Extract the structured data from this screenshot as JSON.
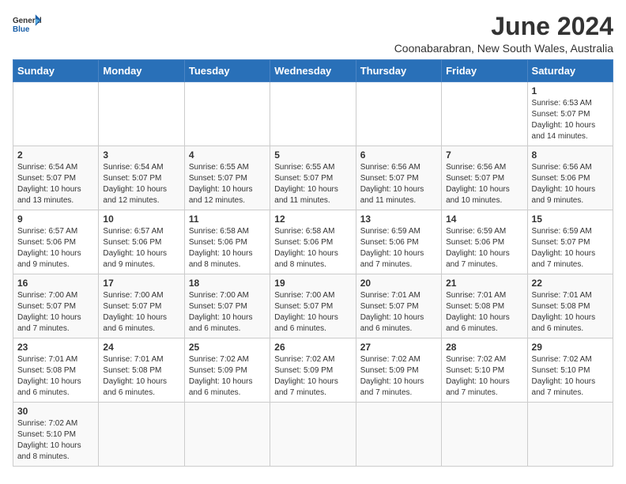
{
  "header": {
    "logo_general": "General",
    "logo_blue": "Blue",
    "month_title": "June 2024",
    "subtitle": "Coonabarabran, New South Wales, Australia"
  },
  "days_of_week": [
    "Sunday",
    "Monday",
    "Tuesday",
    "Wednesday",
    "Thursday",
    "Friday",
    "Saturday"
  ],
  "weeks": [
    {
      "days": [
        {
          "num": "",
          "info": ""
        },
        {
          "num": "",
          "info": ""
        },
        {
          "num": "",
          "info": ""
        },
        {
          "num": "",
          "info": ""
        },
        {
          "num": "",
          "info": ""
        },
        {
          "num": "",
          "info": ""
        },
        {
          "num": "1",
          "info": "Sunrise: 6:53 AM\nSunset: 5:07 PM\nDaylight: 10 hours\nand 14 minutes."
        }
      ]
    },
    {
      "days": [
        {
          "num": "2",
          "info": "Sunrise: 6:54 AM\nSunset: 5:07 PM\nDaylight: 10 hours\nand 13 minutes."
        },
        {
          "num": "3",
          "info": "Sunrise: 6:54 AM\nSunset: 5:07 PM\nDaylight: 10 hours\nand 12 minutes."
        },
        {
          "num": "4",
          "info": "Sunrise: 6:55 AM\nSunset: 5:07 PM\nDaylight: 10 hours\nand 12 minutes."
        },
        {
          "num": "5",
          "info": "Sunrise: 6:55 AM\nSunset: 5:07 PM\nDaylight: 10 hours\nand 11 minutes."
        },
        {
          "num": "6",
          "info": "Sunrise: 6:56 AM\nSunset: 5:07 PM\nDaylight: 10 hours\nand 11 minutes."
        },
        {
          "num": "7",
          "info": "Sunrise: 6:56 AM\nSunset: 5:07 PM\nDaylight: 10 hours\nand 10 minutes."
        },
        {
          "num": "8",
          "info": "Sunrise: 6:56 AM\nSunset: 5:06 PM\nDaylight: 10 hours\nand 9 minutes."
        }
      ]
    },
    {
      "days": [
        {
          "num": "9",
          "info": "Sunrise: 6:57 AM\nSunset: 5:06 PM\nDaylight: 10 hours\nand 9 minutes."
        },
        {
          "num": "10",
          "info": "Sunrise: 6:57 AM\nSunset: 5:06 PM\nDaylight: 10 hours\nand 9 minutes."
        },
        {
          "num": "11",
          "info": "Sunrise: 6:58 AM\nSunset: 5:06 PM\nDaylight: 10 hours\nand 8 minutes."
        },
        {
          "num": "12",
          "info": "Sunrise: 6:58 AM\nSunset: 5:06 PM\nDaylight: 10 hours\nand 8 minutes."
        },
        {
          "num": "13",
          "info": "Sunrise: 6:59 AM\nSunset: 5:06 PM\nDaylight: 10 hours\nand 7 minutes."
        },
        {
          "num": "14",
          "info": "Sunrise: 6:59 AM\nSunset: 5:06 PM\nDaylight: 10 hours\nand 7 minutes."
        },
        {
          "num": "15",
          "info": "Sunrise: 6:59 AM\nSunset: 5:07 PM\nDaylight: 10 hours\nand 7 minutes."
        }
      ]
    },
    {
      "days": [
        {
          "num": "16",
          "info": "Sunrise: 7:00 AM\nSunset: 5:07 PM\nDaylight: 10 hours\nand 7 minutes."
        },
        {
          "num": "17",
          "info": "Sunrise: 7:00 AM\nSunset: 5:07 PM\nDaylight: 10 hours\nand 6 minutes."
        },
        {
          "num": "18",
          "info": "Sunrise: 7:00 AM\nSunset: 5:07 PM\nDaylight: 10 hours\nand 6 minutes."
        },
        {
          "num": "19",
          "info": "Sunrise: 7:00 AM\nSunset: 5:07 PM\nDaylight: 10 hours\nand 6 minutes."
        },
        {
          "num": "20",
          "info": "Sunrise: 7:01 AM\nSunset: 5:07 PM\nDaylight: 10 hours\nand 6 minutes."
        },
        {
          "num": "21",
          "info": "Sunrise: 7:01 AM\nSunset: 5:08 PM\nDaylight: 10 hours\nand 6 minutes."
        },
        {
          "num": "22",
          "info": "Sunrise: 7:01 AM\nSunset: 5:08 PM\nDaylight: 10 hours\nand 6 minutes."
        }
      ]
    },
    {
      "days": [
        {
          "num": "23",
          "info": "Sunrise: 7:01 AM\nSunset: 5:08 PM\nDaylight: 10 hours\nand 6 minutes."
        },
        {
          "num": "24",
          "info": "Sunrise: 7:01 AM\nSunset: 5:08 PM\nDaylight: 10 hours\nand 6 minutes."
        },
        {
          "num": "25",
          "info": "Sunrise: 7:02 AM\nSunset: 5:09 PM\nDaylight: 10 hours\nand 6 minutes."
        },
        {
          "num": "26",
          "info": "Sunrise: 7:02 AM\nSunset: 5:09 PM\nDaylight: 10 hours\nand 7 minutes."
        },
        {
          "num": "27",
          "info": "Sunrise: 7:02 AM\nSunset: 5:09 PM\nDaylight: 10 hours\nand 7 minutes."
        },
        {
          "num": "28",
          "info": "Sunrise: 7:02 AM\nSunset: 5:10 PM\nDaylight: 10 hours\nand 7 minutes."
        },
        {
          "num": "29",
          "info": "Sunrise: 7:02 AM\nSunset: 5:10 PM\nDaylight: 10 hours\nand 7 minutes."
        }
      ]
    },
    {
      "days": [
        {
          "num": "30",
          "info": "Sunrise: 7:02 AM\nSunset: 5:10 PM\nDaylight: 10 hours\nand 8 minutes."
        },
        {
          "num": "",
          "info": ""
        },
        {
          "num": "",
          "info": ""
        },
        {
          "num": "",
          "info": ""
        },
        {
          "num": "",
          "info": ""
        },
        {
          "num": "",
          "info": ""
        },
        {
          "num": "",
          "info": ""
        }
      ]
    }
  ]
}
